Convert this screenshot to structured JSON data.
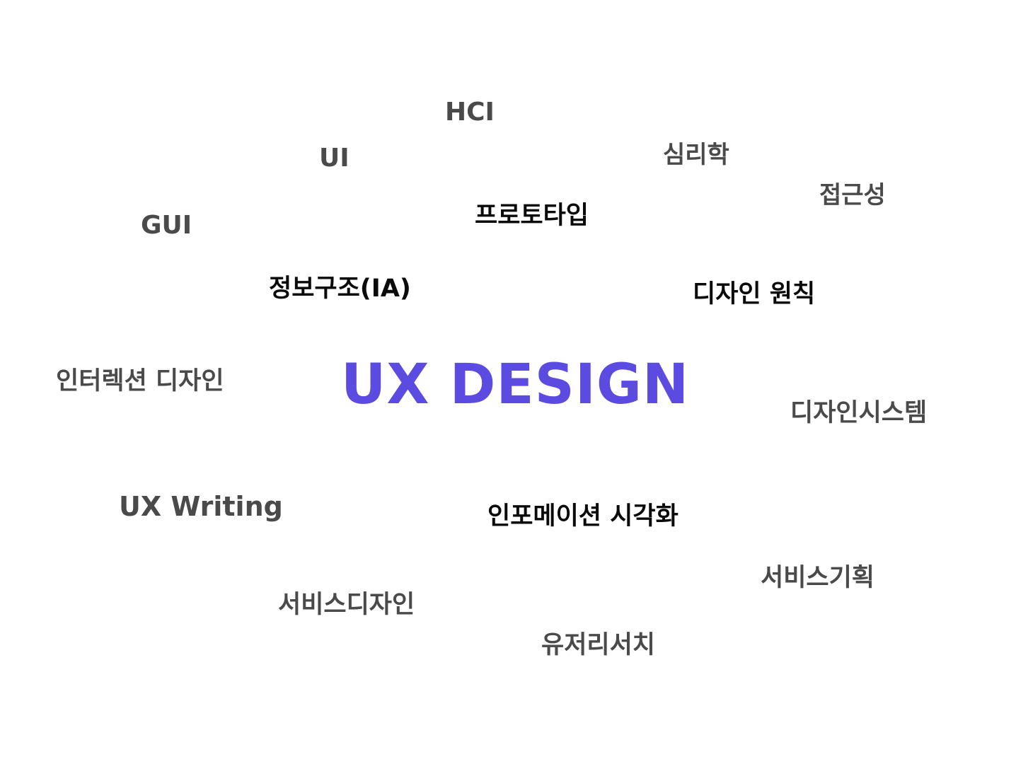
{
  "cloud": {
    "main": "UX DESIGN",
    "hci": "HCI",
    "ui": "UI",
    "psychology": "심리학",
    "accessibility": "접근성",
    "gui": "GUI",
    "prototype": "프로토타입",
    "information_architecture": "정보구조(IA)",
    "design_principles": "디자인 원칙",
    "interaction_design": "인터렉션 디자인",
    "design_system": "디자인시스템",
    "ux_writing": "UX Writing",
    "information_visualization": "인포메이션 시각화",
    "service_planning": "서비스기획",
    "service_design": "서비스디자인",
    "user_research": "유저리서치"
  },
  "colors": {
    "accent": "#5b4be1",
    "primary_text": "#0a0a0a",
    "secondary_text": "#4a4a4a",
    "background": "#ffffff"
  }
}
